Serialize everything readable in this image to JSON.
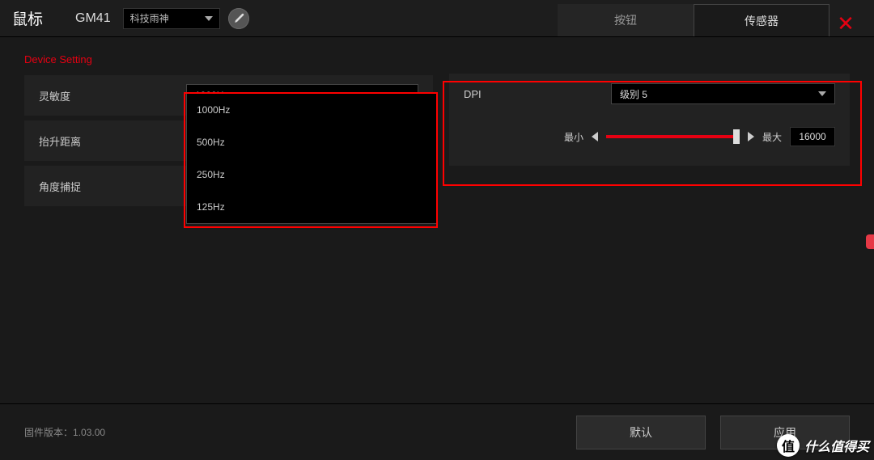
{
  "header": {
    "device_type": "鼠标",
    "device_model": "GM41",
    "profile_selected": "科技雨神",
    "edit_icon": "pencil-icon"
  },
  "tabs": {
    "button_tab": "按钮",
    "sensor_tab": "传感器"
  },
  "close_glyph": "✕",
  "section_title": "Device Setting",
  "settings": {
    "sensitivity": {
      "label": "灵敏度",
      "value": "1000Hz"
    },
    "lift_distance": {
      "label": "抬升距离"
    },
    "angle_snap": {
      "label": "角度捕捉"
    }
  },
  "polling_options": [
    "1000Hz",
    "500Hz",
    "250Hz",
    "125Hz"
  ],
  "dpi": {
    "label": "DPI",
    "level_selected": "级别 5",
    "min_label": "最小",
    "max_label": "最大",
    "value": "16000"
  },
  "footer": {
    "firmware_label": "固件版本：",
    "firmware_version": "1.03.00",
    "default_btn": "默认",
    "apply_btn": "应用"
  },
  "watermark": {
    "circle": "值",
    "text": "什么值得买"
  }
}
